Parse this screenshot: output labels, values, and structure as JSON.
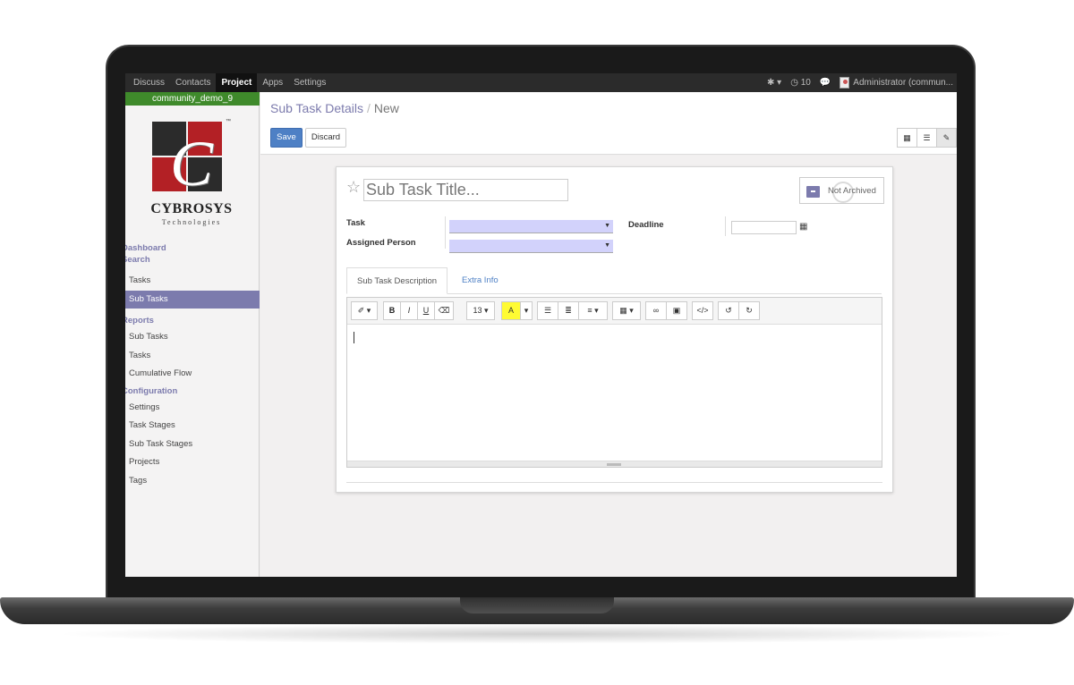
{
  "topbar": {
    "menu": [
      "Discuss",
      "Contacts",
      "Project",
      "Apps",
      "Settings"
    ],
    "active_menu": "Project",
    "notification_count": "10",
    "user": "Administrator (commun..."
  },
  "sidebar": {
    "db_name": "community_demo_9",
    "brand": "CYBROSYS",
    "brand_sub": "Technologies",
    "brand_tm": "™",
    "sections": {
      "dashboard": "Dashboard",
      "search": "Search",
      "reports": "Reports",
      "configuration": "Configuration"
    },
    "search_items": [
      "Tasks",
      "Sub Tasks"
    ],
    "report_items": [
      "Sub Tasks",
      "Tasks",
      "Cumulative Flow"
    ],
    "config_items": [
      "Settings",
      "Task Stages",
      "Sub Task Stages",
      "Projects",
      "Tags"
    ]
  },
  "control_panel": {
    "breadcrumb_parent": "Sub Task Details",
    "breadcrumb_separator": "/",
    "breadcrumb_current": "New",
    "save_label": "Save",
    "discard_label": "Discard"
  },
  "form": {
    "title_placeholder": "Sub Task Title...",
    "archive_label": "Not Archived",
    "task_label": "Task",
    "assigned_label": "Assigned Person",
    "deadline_label": "Deadline",
    "tabs": [
      "Sub Task Description",
      "Extra Info"
    ],
    "toolbar": {
      "font_size": "13",
      "bold": "B",
      "italic": "I",
      "underline": "U",
      "color": "A"
    }
  },
  "colors": {
    "accent": "#7c7bad",
    "primary_button": "#4e80c5",
    "db_bar": "#3f8a2b",
    "logo_red": "#b32025",
    "logo_dark": "#2b2b2b"
  }
}
